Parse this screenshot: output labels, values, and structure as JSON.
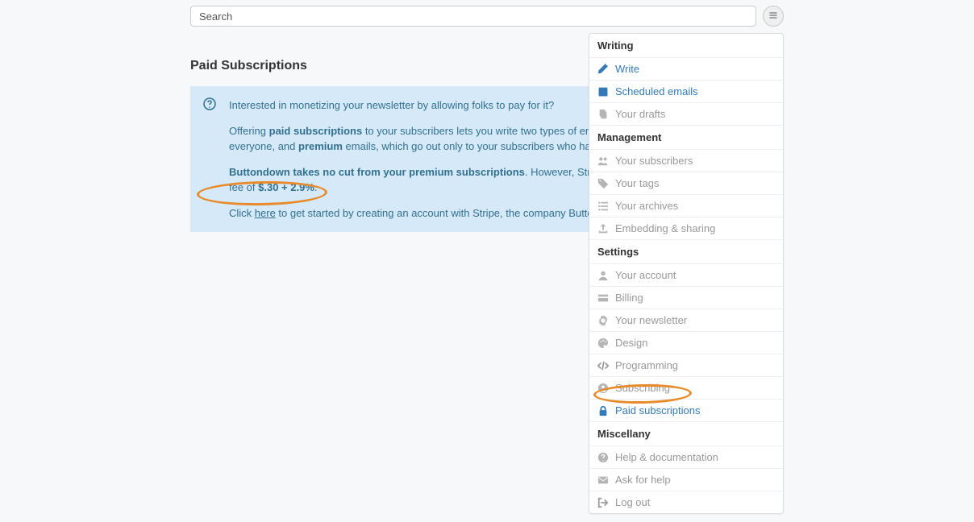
{
  "search": {
    "placeholder": "Search"
  },
  "page": {
    "title": "Paid Subscriptions"
  },
  "info": {
    "p1": "Interested in monetizing your newsletter by allowing folks to pay for it?",
    "p2a": "Offering ",
    "p2b": "paid subscriptions",
    "p2c": " to your subscribers lets you write two types of emails: free emails, which go out to everyone, and ",
    "p2d": "premium",
    "p2e": " emails, which go out only to your subscribers who have paid for a subscription.",
    "p3a": "Buttondown takes no cut from your premium subscriptions",
    "p3b": ". However, Stripe (our payment processor) takes a fee of ",
    "p3c": "$.30 + 2.9%",
    "p3d": ".",
    "p4a": "Click ",
    "p4b": "here",
    "p4c": " to get started by creating an account with Stripe, the company Buttondown uses to process payments."
  },
  "menu": {
    "sections": [
      {
        "header": "Writing",
        "items": [
          {
            "icon": "pencil",
            "label": "Write",
            "active": true
          },
          {
            "icon": "calendar",
            "label": "Scheduled emails",
            "active": true
          },
          {
            "icon": "copy",
            "label": "Your drafts",
            "active": false
          }
        ]
      },
      {
        "header": "Management",
        "items": [
          {
            "icon": "users",
            "label": "Your subscribers",
            "active": false
          },
          {
            "icon": "tag",
            "label": "Your tags",
            "active": false
          },
          {
            "icon": "list",
            "label": "Your archives",
            "active": false
          },
          {
            "icon": "share",
            "label": "Embedding & sharing",
            "active": false
          }
        ]
      },
      {
        "header": "Settings",
        "items": [
          {
            "icon": "user",
            "label": "Your account",
            "active": false
          },
          {
            "icon": "card",
            "label": "Billing",
            "active": false
          },
          {
            "icon": "gear",
            "label": "Your newsletter",
            "active": false
          },
          {
            "icon": "palette",
            "label": "Design",
            "active": false
          },
          {
            "icon": "code",
            "label": "Programming",
            "active": false
          },
          {
            "icon": "usercircle",
            "label": "Subscribing",
            "active": false
          },
          {
            "icon": "lock",
            "label": "Paid subscriptions",
            "active": true
          }
        ]
      },
      {
        "header": "Miscellany",
        "items": [
          {
            "icon": "question",
            "label": "Help & documentation",
            "active": false
          },
          {
            "icon": "envelope",
            "label": "Ask for help",
            "active": false
          },
          {
            "icon": "signout",
            "label": "Log out",
            "active": false
          }
        ]
      }
    ]
  }
}
